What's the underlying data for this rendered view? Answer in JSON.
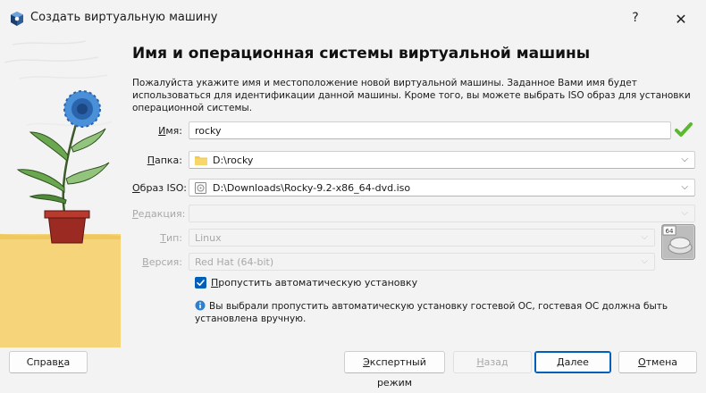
{
  "window": {
    "title": "Создать виртуальную машину",
    "help_glyph": "?",
    "close_glyph": "✕"
  },
  "page": {
    "heading": "Имя и операционная системы виртуальной машины",
    "description": "Пожалуйста укажите имя и местоположение новой виртуальной машины. Заданное Вами имя будет использоваться для идентификации данной машины. Кроме того, вы можете выбрать ISO образ для установки операционной системы."
  },
  "form": {
    "name": {
      "label_ul": "И",
      "label_rest": "мя:",
      "value": "rocky",
      "valid": true
    },
    "folder": {
      "label_ul": "П",
      "label_rest": "апка:",
      "value": "D:\\rocky"
    },
    "iso": {
      "label_ul": "О",
      "label_rest": "браз ISO:",
      "value": "D:\\Downloads\\Rocky-9.2-x86_64-dvd.iso"
    },
    "edition": {
      "label_ul": "Р",
      "label_rest": "едакция:",
      "value": "",
      "disabled": true
    },
    "type": {
      "label_ul": "Т",
      "label_rest": "ип:",
      "value": "Linux",
      "disabled": true
    },
    "version": {
      "label_ul": "В",
      "label_rest": "ерсия:",
      "value": "Red Hat (64-bit)",
      "disabled": true
    },
    "os_badge": "64"
  },
  "unattended": {
    "checked": true,
    "label_ul": "П",
    "label_rest": "ропустить автоматическую установку",
    "info": "Вы выбрали пропустить автоматическую установку гостевой ОС, гостевая ОС должна быть установлена вручную."
  },
  "buttons": {
    "help_pre": "Справ",
    "help_ul": "к",
    "help_post": "а",
    "expert_ul": "Э",
    "expert_rest": "кспертный режим",
    "back_ul": "Н",
    "back_rest": "азад",
    "next_ul": "Д",
    "next_rest": "алее",
    "cancel_ul": "О",
    "cancel_rest": "тмена"
  },
  "colors": {
    "accent": "#005fb8",
    "valid": "#5cb82e",
    "folder": "#f2c94c",
    "sand": "#f5d47a"
  }
}
